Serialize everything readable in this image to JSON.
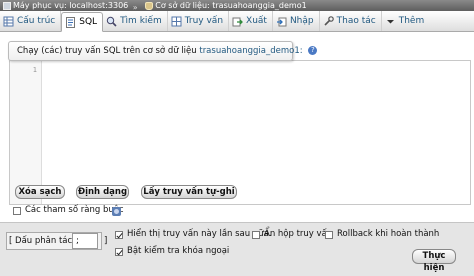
{
  "breadcrumb": {
    "server": "Máy phục vụ: localhost:3306",
    "separator": "»",
    "database": "Cơ sở dữ liệu: trasuahoanggia_demo1"
  },
  "tabs": [
    {
      "label": "Cấu trúc",
      "icon": "structure-icon",
      "active": false
    },
    {
      "label": "SQL",
      "icon": "sql-icon",
      "active": true
    },
    {
      "label": "Tìm kiếm",
      "icon": "search-icon",
      "active": false
    },
    {
      "label": "Truy vấn",
      "icon": "query-icon",
      "active": false
    },
    {
      "label": "Xuất",
      "icon": "export-icon",
      "active": false
    },
    {
      "label": "Nhập",
      "icon": "import-icon",
      "active": false
    },
    {
      "label": "Thao tác",
      "icon": "operations-icon",
      "active": false
    },
    {
      "label": "Thêm",
      "icon": "chevron-down-icon",
      "active": false
    }
  ],
  "query_panel": {
    "legend_prefix": "Chạy (các) truy vấn SQL trên cơ sở dữ liệu",
    "database_name": "trasuahoanggia_demo1:",
    "editor_line_number": "1",
    "editor_value": ""
  },
  "buttons": {
    "clear": "Xóa sạch",
    "format": "Định dạng",
    "get_auto_saved": "Lấy truy vấn tự-ghi"
  },
  "bind_params": {
    "label": "Các tham số ràng buộc",
    "checked": false
  },
  "options": {
    "delimiter_label": "[ Dấu phân tách",
    "delimiter_value": ";",
    "delimiter_close": "]",
    "show_query_label": "Hiển thị truy vấn này lần sau nữa.",
    "show_query_checked": true,
    "hide_query_box_label": "Ẩn hộp truy vấn",
    "hide_query_box_checked": false,
    "rollback_label": "Rollback khi hoàn thành",
    "rollback_checked": false,
    "fk_check_label": "Bật kiểm tra khóa ngoại",
    "fk_check_checked": true,
    "go_button": "Thực hiện"
  },
  "colors": {
    "tab_link": "#235a81",
    "breadcrumb_bg": "#6f6f6f",
    "accent": "#4a79c4"
  }
}
